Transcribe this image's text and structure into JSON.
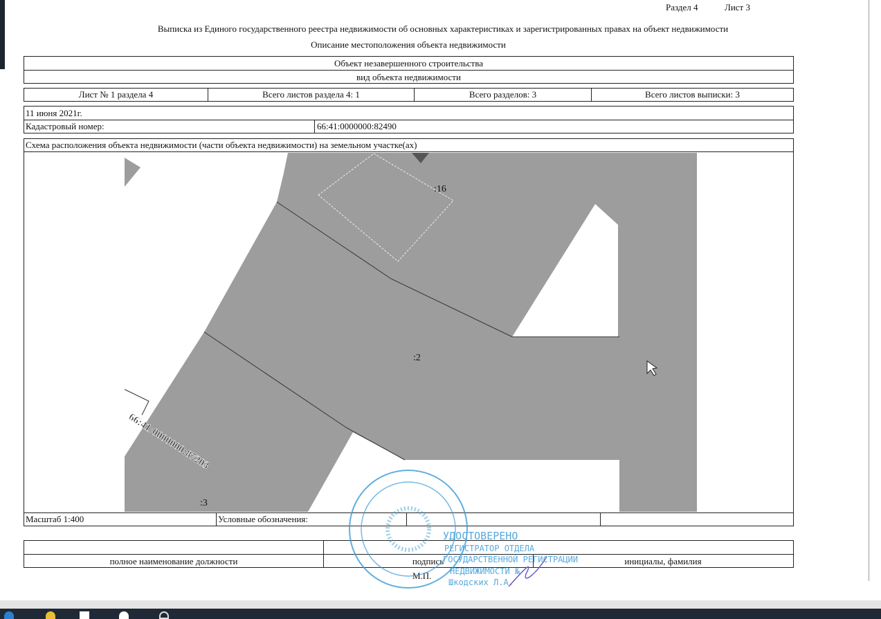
{
  "header": {
    "section": "Раздел 4",
    "sheet": "Лист 3"
  },
  "title": "Выписка из Единого государственного реестра недвижимости об основных характеристиках и зарегистрированных правах на объект недвижимости",
  "subtitle": "Описание местоположения объекта недвижимости",
  "object_type": "Объект незавершенного строительства",
  "object_type_caption": "вид объекта недвижимости",
  "sheet_info": [
    "Лист № 1 раздела 4",
    "Всего листов раздела 4: 1",
    "Всего разделов: 3",
    "Всего листов выписки: 3"
  ],
  "date": "11 июня 2021г.",
  "cadastral_label": "Кадастровый номер:",
  "cadastral_number": "66:41:0000000:82490",
  "scheme_title": "Схема расположения объекта недвижимости (части объекта недвижимости) на земельном участке(ах)",
  "map": {
    "label_16": ":16",
    "label_2": ":2",
    "label_3": ":3",
    "parcel_number": "66:41:0000000:87203"
  },
  "scale": "Масштаб 1:400",
  "legend_label": "Условные обозначения:",
  "footer": {
    "position": "полное наименование должности",
    "signature": "подпись",
    "initials": "инициалы, фамилия",
    "seal": "М.П."
  },
  "stamp": {
    "line1": "УДОСТОВЕРЕНО",
    "line2": "РЕГИСТРАТОР ОТДЕЛА",
    "line3": "ГОСУДАРСТВЕННОЙ РЕГИСТРАЦИИ",
    "line4": "НЕДВИЖИМОСТИ №",
    "line5": "Шкодских Л.А."
  },
  "colors": {
    "stamp": "#3a9bd6",
    "map_gray": "#9a9a9a",
    "taskbar": "#1f2a36"
  }
}
